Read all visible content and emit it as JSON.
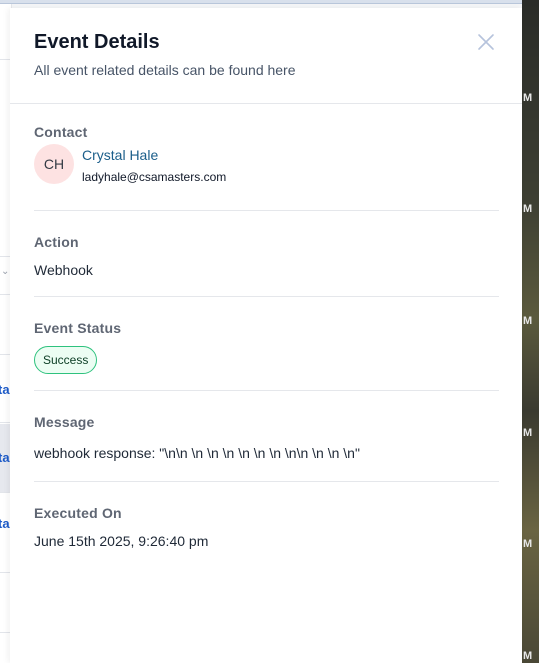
{
  "drawer": {
    "title": "Event Details",
    "subtitle": "All event related details can be found here"
  },
  "contact": {
    "label": "Contact",
    "initials": "CH",
    "name": "Crystal Hale",
    "email": "ladyhale@csamasters.com"
  },
  "action": {
    "label": "Action",
    "value": "Webhook"
  },
  "event_status": {
    "label": "Event Status",
    "badge": "Success"
  },
  "message": {
    "label": "Message",
    "value": "webhook response: \"\\n\\n \\n \\n \\n \\n \\n \\n \\n\\n \\n \\n \\n\""
  },
  "executed_on": {
    "label": "Executed On",
    "value": "June 15th 2025, 9:26:40 pm"
  },
  "colors": {
    "badge_border": "#2ec27e",
    "badge_bg": "#ecfdf3",
    "link": "#1b5e8a",
    "avatar_bg": "#fde2e2"
  },
  "icons": {
    "close": "close-icon"
  },
  "background": {
    "left_glyph": "ta",
    "right_glyph": "M"
  }
}
